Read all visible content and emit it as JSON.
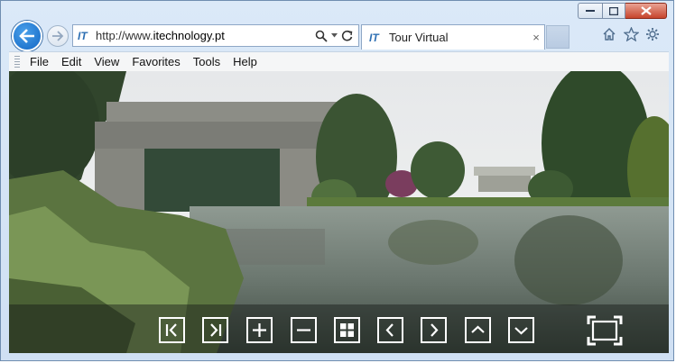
{
  "browser": {
    "address_url_prefix": "http://www.",
    "address_url_domain": "itechnology.pt",
    "favicon_text": "IT",
    "tab_title": "Tour Virtual",
    "tab_close": "×"
  },
  "menu": {
    "items": [
      "File",
      "Edit",
      "View",
      "Favorites",
      "Tools",
      "Help"
    ]
  },
  "icons": {
    "toolbar": [
      "home-icon",
      "star-icon",
      "gear-icon"
    ],
    "window_controls": [
      "minimize-icon",
      "maximize-icon",
      "close-icon"
    ],
    "tour_controls": [
      "first-icon",
      "last-icon",
      "zoom-in-icon",
      "zoom-out-icon",
      "thumbnails-icon",
      "previous-icon",
      "next-icon",
      "up-icon",
      "down-icon",
      "fullscreen-icon"
    ]
  },
  "colors": {
    "frame": "#cfe0f3",
    "back_button": "#1166c4",
    "close_button": "#c6442c",
    "control_border": "#ffffff"
  }
}
